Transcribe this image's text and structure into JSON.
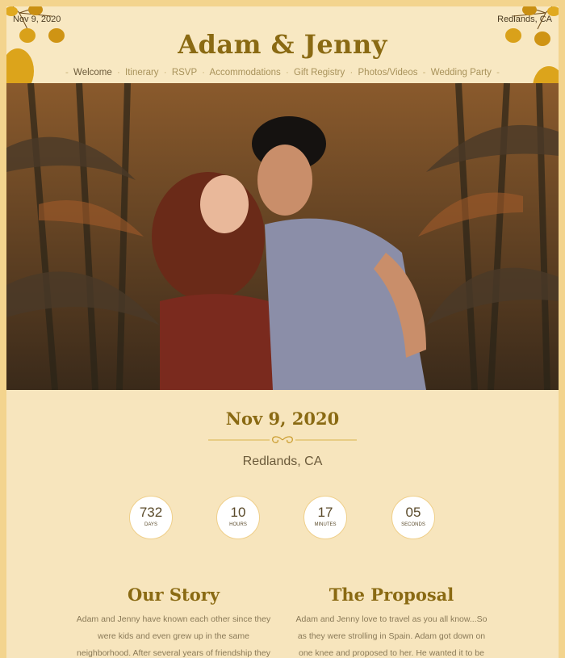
{
  "header": {
    "date_small": "Nov 9, 2020",
    "location_small": "Redlands, CA",
    "title": "Adam & Jenny",
    "nav": [
      {
        "label": "Welcome",
        "active": true
      },
      {
        "label": "Itinerary",
        "active": false
      },
      {
        "label": "RSVP",
        "active": false
      },
      {
        "label": "Accommodations",
        "active": false
      },
      {
        "label": "Gift Registry",
        "active": false
      },
      {
        "label": "Photos/Videos",
        "active": false
      },
      {
        "label": "Wedding Party",
        "active": false
      }
    ]
  },
  "event": {
    "date": "Nov 9, 2020",
    "location": "Redlands, CA"
  },
  "countdown": [
    {
      "value": "732",
      "label": "DAYS"
    },
    {
      "value": "10",
      "label": "HOURS"
    },
    {
      "value": "17",
      "label": "MINUTES"
    },
    {
      "value": "05",
      "label": "SECONDS"
    }
  ],
  "sections": {
    "story": {
      "title": "Our Story",
      "text": "Adam and Jenny have known each other since they were kids and even grew up in the same neighborhood. After several years of friendship they became officially a couple"
    },
    "proposal": {
      "title": "The Proposal",
      "text": "Adam and Jenny love to travel as you all know...So as they were strolling in Spain. Adam got down on one knee and proposed to her. He wanted it to be random and"
    }
  },
  "colors": {
    "accent": "#8a6a13",
    "background": "#f7e5bd",
    "frame": "#f3d48e"
  },
  "icons": [
    "leaf-icon",
    "flourish-divider-icon"
  ]
}
